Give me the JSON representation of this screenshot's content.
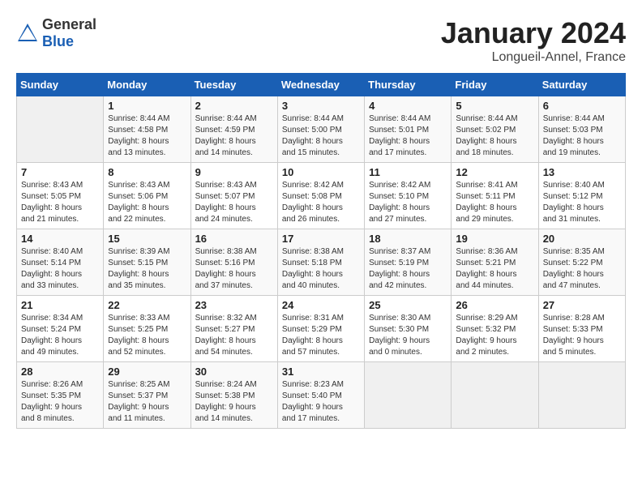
{
  "header": {
    "logo": {
      "text_general": "General",
      "text_blue": "Blue"
    },
    "title": "January 2024",
    "subtitle": "Longueil-Annel, France"
  },
  "calendar": {
    "weekdays": [
      "Sunday",
      "Monday",
      "Tuesday",
      "Wednesday",
      "Thursday",
      "Friday",
      "Saturday"
    ],
    "weeks": [
      [
        {
          "day": null,
          "info": null
        },
        {
          "day": "1",
          "info": "Sunrise: 8:44 AM\nSunset: 4:58 PM\nDaylight: 8 hours\nand 13 minutes."
        },
        {
          "day": "2",
          "info": "Sunrise: 8:44 AM\nSunset: 4:59 PM\nDaylight: 8 hours\nand 14 minutes."
        },
        {
          "day": "3",
          "info": "Sunrise: 8:44 AM\nSunset: 5:00 PM\nDaylight: 8 hours\nand 15 minutes."
        },
        {
          "day": "4",
          "info": "Sunrise: 8:44 AM\nSunset: 5:01 PM\nDaylight: 8 hours\nand 17 minutes."
        },
        {
          "day": "5",
          "info": "Sunrise: 8:44 AM\nSunset: 5:02 PM\nDaylight: 8 hours\nand 18 minutes."
        },
        {
          "day": "6",
          "info": "Sunrise: 8:44 AM\nSunset: 5:03 PM\nDaylight: 8 hours\nand 19 minutes."
        }
      ],
      [
        {
          "day": "7",
          "info": "Sunrise: 8:43 AM\nSunset: 5:05 PM\nDaylight: 8 hours\nand 21 minutes."
        },
        {
          "day": "8",
          "info": "Sunrise: 8:43 AM\nSunset: 5:06 PM\nDaylight: 8 hours\nand 22 minutes."
        },
        {
          "day": "9",
          "info": "Sunrise: 8:43 AM\nSunset: 5:07 PM\nDaylight: 8 hours\nand 24 minutes."
        },
        {
          "day": "10",
          "info": "Sunrise: 8:42 AM\nSunset: 5:08 PM\nDaylight: 8 hours\nand 26 minutes."
        },
        {
          "day": "11",
          "info": "Sunrise: 8:42 AM\nSunset: 5:10 PM\nDaylight: 8 hours\nand 27 minutes."
        },
        {
          "day": "12",
          "info": "Sunrise: 8:41 AM\nSunset: 5:11 PM\nDaylight: 8 hours\nand 29 minutes."
        },
        {
          "day": "13",
          "info": "Sunrise: 8:40 AM\nSunset: 5:12 PM\nDaylight: 8 hours\nand 31 minutes."
        }
      ],
      [
        {
          "day": "14",
          "info": "Sunrise: 8:40 AM\nSunset: 5:14 PM\nDaylight: 8 hours\nand 33 minutes."
        },
        {
          "day": "15",
          "info": "Sunrise: 8:39 AM\nSunset: 5:15 PM\nDaylight: 8 hours\nand 35 minutes."
        },
        {
          "day": "16",
          "info": "Sunrise: 8:38 AM\nSunset: 5:16 PM\nDaylight: 8 hours\nand 37 minutes."
        },
        {
          "day": "17",
          "info": "Sunrise: 8:38 AM\nSunset: 5:18 PM\nDaylight: 8 hours\nand 40 minutes."
        },
        {
          "day": "18",
          "info": "Sunrise: 8:37 AM\nSunset: 5:19 PM\nDaylight: 8 hours\nand 42 minutes."
        },
        {
          "day": "19",
          "info": "Sunrise: 8:36 AM\nSunset: 5:21 PM\nDaylight: 8 hours\nand 44 minutes."
        },
        {
          "day": "20",
          "info": "Sunrise: 8:35 AM\nSunset: 5:22 PM\nDaylight: 8 hours\nand 47 minutes."
        }
      ],
      [
        {
          "day": "21",
          "info": "Sunrise: 8:34 AM\nSunset: 5:24 PM\nDaylight: 8 hours\nand 49 minutes."
        },
        {
          "day": "22",
          "info": "Sunrise: 8:33 AM\nSunset: 5:25 PM\nDaylight: 8 hours\nand 52 minutes."
        },
        {
          "day": "23",
          "info": "Sunrise: 8:32 AM\nSunset: 5:27 PM\nDaylight: 8 hours\nand 54 minutes."
        },
        {
          "day": "24",
          "info": "Sunrise: 8:31 AM\nSunset: 5:29 PM\nDaylight: 8 hours\nand 57 minutes."
        },
        {
          "day": "25",
          "info": "Sunrise: 8:30 AM\nSunset: 5:30 PM\nDaylight: 9 hours\nand 0 minutes."
        },
        {
          "day": "26",
          "info": "Sunrise: 8:29 AM\nSunset: 5:32 PM\nDaylight: 9 hours\nand 2 minutes."
        },
        {
          "day": "27",
          "info": "Sunrise: 8:28 AM\nSunset: 5:33 PM\nDaylight: 9 hours\nand 5 minutes."
        }
      ],
      [
        {
          "day": "28",
          "info": "Sunrise: 8:26 AM\nSunset: 5:35 PM\nDaylight: 9 hours\nand 8 minutes."
        },
        {
          "day": "29",
          "info": "Sunrise: 8:25 AM\nSunset: 5:37 PM\nDaylight: 9 hours\nand 11 minutes."
        },
        {
          "day": "30",
          "info": "Sunrise: 8:24 AM\nSunset: 5:38 PM\nDaylight: 9 hours\nand 14 minutes."
        },
        {
          "day": "31",
          "info": "Sunrise: 8:23 AM\nSunset: 5:40 PM\nDaylight: 9 hours\nand 17 minutes."
        },
        {
          "day": null,
          "info": null
        },
        {
          "day": null,
          "info": null
        },
        {
          "day": null,
          "info": null
        }
      ]
    ]
  }
}
